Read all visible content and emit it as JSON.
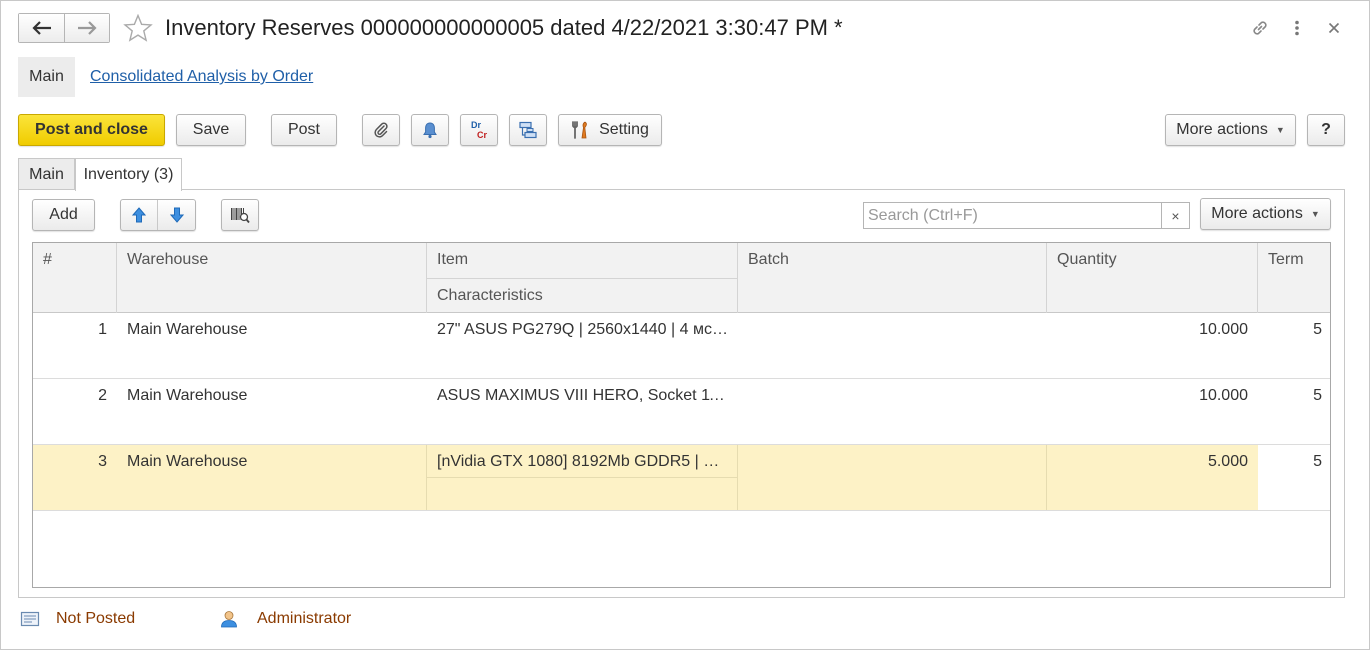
{
  "window": {
    "title": "Inventory Reserves 000000000000005 dated 4/22/2021 3:30:47 PM *"
  },
  "sections": {
    "main_label": "Main",
    "link_label": "Consolidated Analysis by Order"
  },
  "toolbar": {
    "post_and_close": "Post and close",
    "save": "Save",
    "post": "Post",
    "dr": "Dr",
    "cr": "Cr",
    "setting": "Setting",
    "more_actions": "More actions",
    "help": "?"
  },
  "tabs": [
    {
      "label": "Main",
      "active": false
    },
    {
      "label": "Inventory (3)",
      "active": true
    }
  ],
  "table_toolbar": {
    "add": "Add",
    "more_actions": "More actions",
    "search_placeholder": "Search (Ctrl+F)",
    "search_value": "",
    "clear": "×"
  },
  "table": {
    "columns": {
      "num": "#",
      "warehouse": "Warehouse",
      "item": "Item",
      "characteristics": "Characteristics",
      "batch": "Batch",
      "quantity": "Quantity",
      "term": "Term"
    },
    "rows": [
      {
        "num": "1",
        "warehouse": "Main Warehouse",
        "item": "27\" ASUS PG279Q | 2560x1440 | 4 мс…",
        "characteristics": "",
        "batch": "",
        "quantity": "10.000",
        "term": "5"
      },
      {
        "num": "2",
        "warehouse": "Main Warehouse",
        "item": "ASUS MAXIMUS VIII HERO, Socket 11…",
        "characteristics": "",
        "batch": "",
        "quantity": "10.000",
        "term": "5"
      },
      {
        "num": "3",
        "warehouse": "Main Warehouse",
        "item": "[nVidia GTX 1080] 8192Mb GDDR5 | …",
        "characteristics": "",
        "batch": "",
        "quantity": "5.000",
        "term": "5"
      }
    ]
  },
  "footer": {
    "status": "Not Posted",
    "user": "Administrator"
  },
  "colors": {
    "accent_yellow": "#f5d30f",
    "link_blue": "#1f5fa8",
    "selected_row": "#fdf2c6",
    "footer_text": "#8a3a00"
  }
}
